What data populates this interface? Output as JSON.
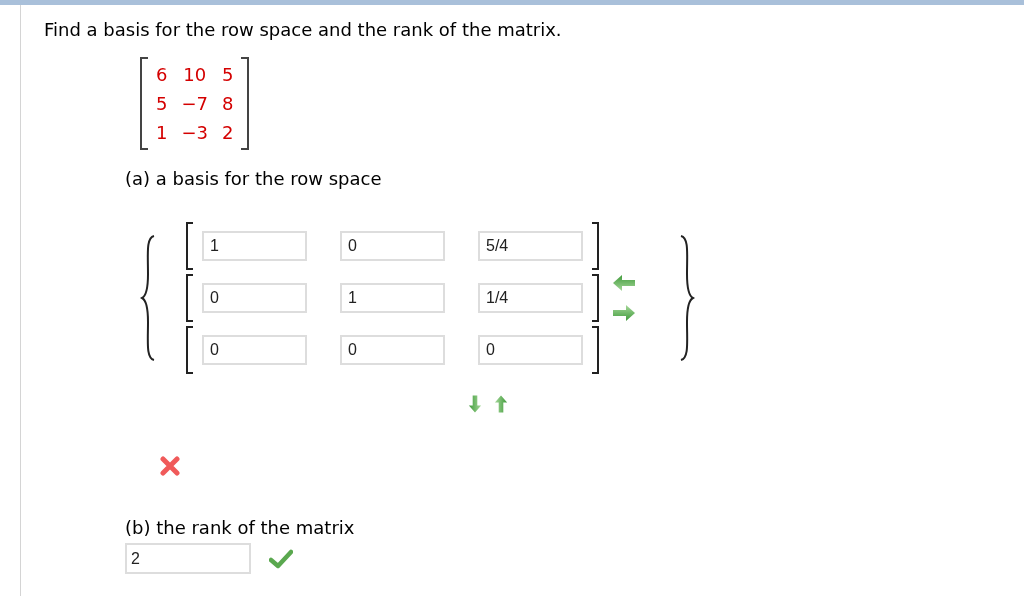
{
  "question": "Find a basis for the row space and the rank of the matrix.",
  "matrix": [
    [
      "6",
      "10",
      "5"
    ],
    [
      "5",
      "−7",
      "8"
    ],
    [
      "1",
      "−3",
      "2"
    ]
  ],
  "part_a": {
    "label": "(a) a basis for the row space",
    "vectors": [
      [
        "1",
        "0",
        "5/4"
      ],
      [
        "0",
        "1",
        "1/4"
      ],
      [
        "0",
        "0",
        "0"
      ]
    ],
    "correct": false
  },
  "part_b": {
    "label": "(b) the rank of the matrix",
    "value": "2",
    "correct": true
  }
}
